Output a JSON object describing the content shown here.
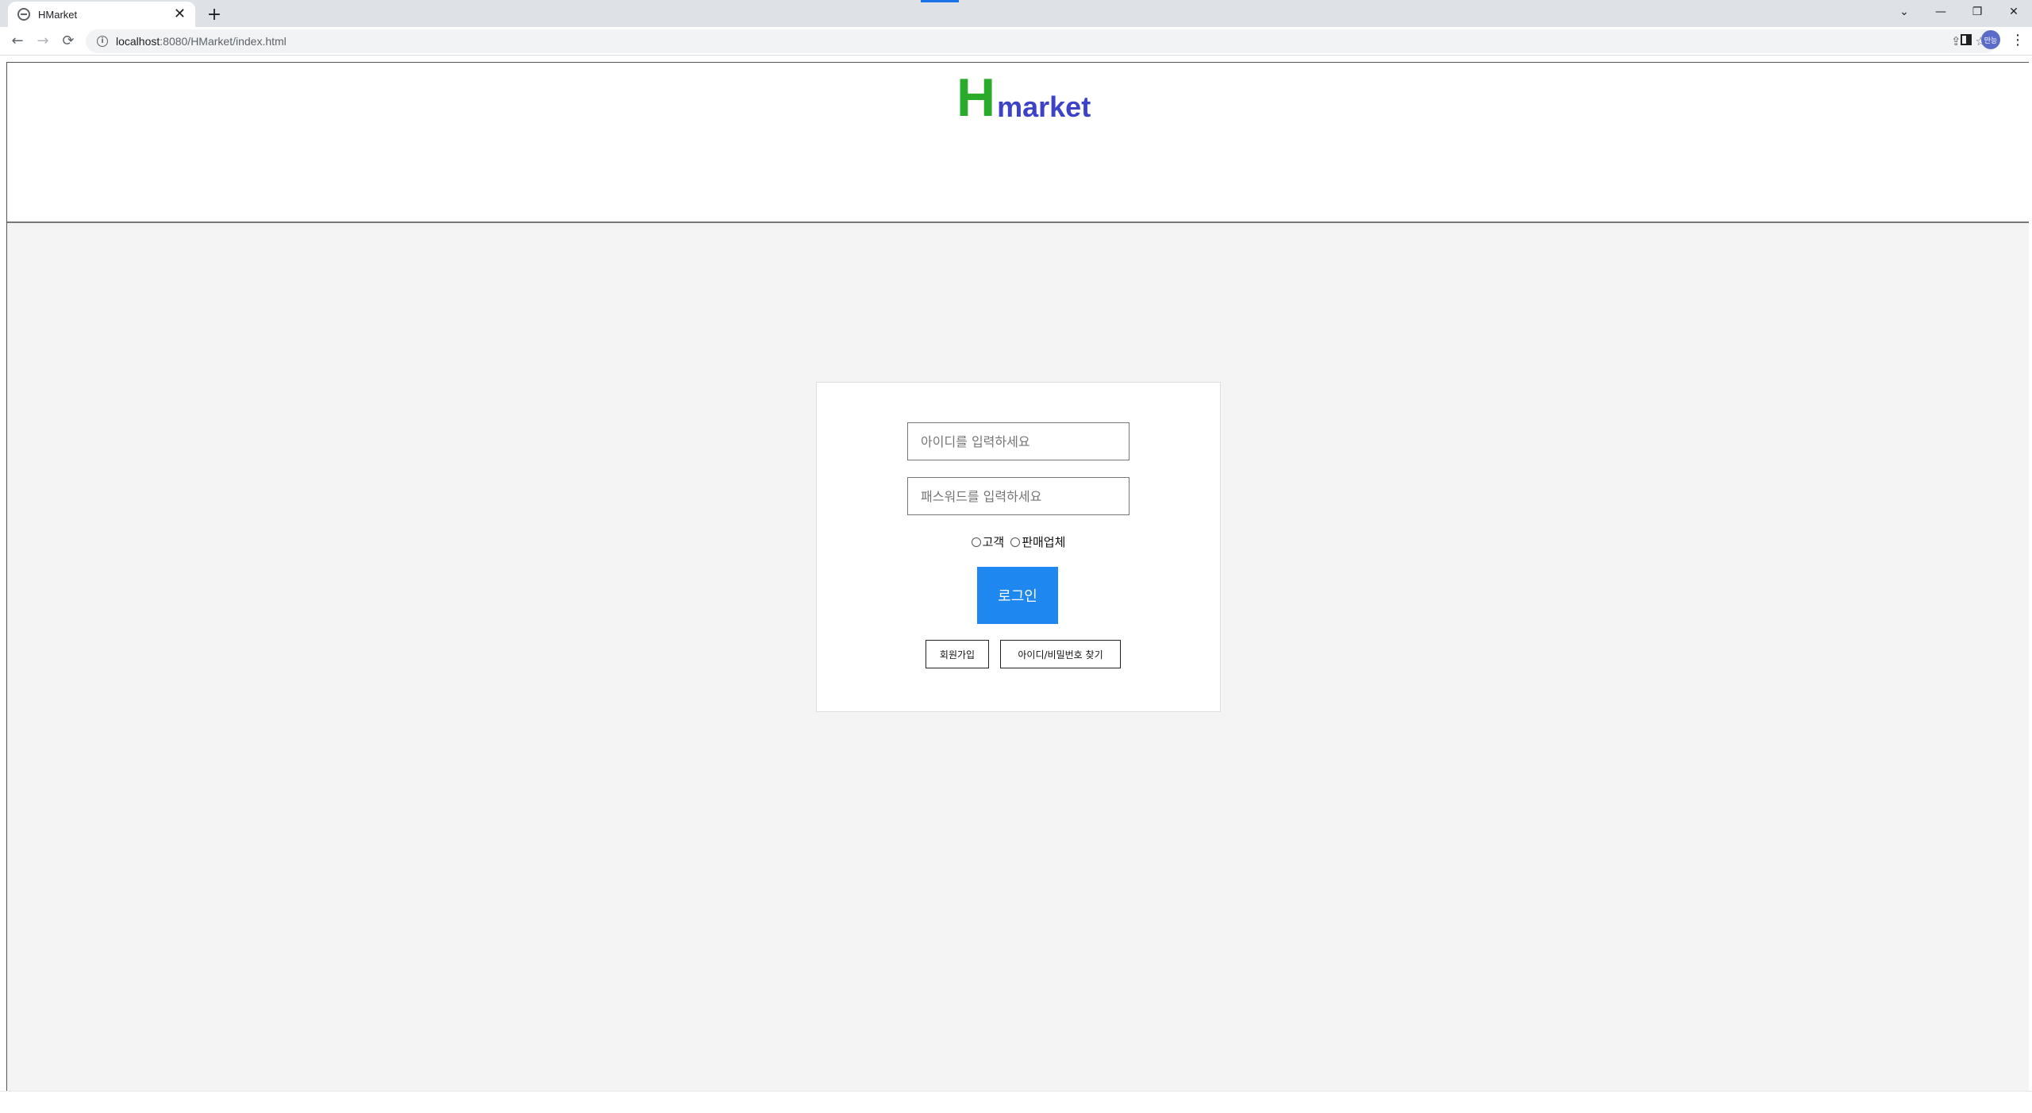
{
  "browser": {
    "tab_title": "HMarket",
    "tab_close": "✕",
    "new_tab": "+",
    "url_host": "localhost",
    "url_rest": ":8080/HMarket/index.html",
    "avatar_text": "만능",
    "window_controls": {
      "dropdown": "⌄",
      "minimize": "—",
      "restore": "❐",
      "close": "✕"
    },
    "nav": {
      "back": "←",
      "forward": "→",
      "reload": "⟳"
    },
    "icons": {
      "share": "⇪",
      "bookmark": "☆",
      "menu": "⋮"
    }
  },
  "header": {
    "logo_h": "H",
    "logo_market": "market"
  },
  "login": {
    "id_placeholder": "아이디를 입력하세요",
    "pw_placeholder": "패스워드를 입력하세요",
    "radio_customer": "고객",
    "radio_seller": "판매업체",
    "login_button": "로그인",
    "signup_button": "회원가입",
    "find_button": "아이디/비밀번호 찾기"
  },
  "colors": {
    "logo_h": "#2aaa2a",
    "logo_market": "#3d43c6",
    "login_button": "#1e88f0",
    "content_bg": "#f4f4f4"
  }
}
